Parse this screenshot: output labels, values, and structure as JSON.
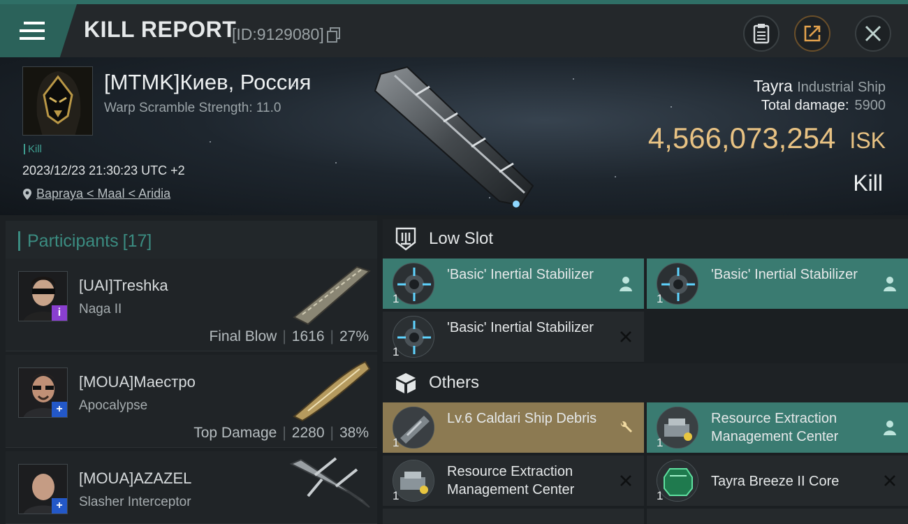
{
  "header": {
    "title": "KILL REPORT",
    "report_id": "[ID:9129080]",
    "icons": [
      "menu-icon",
      "copy-icon",
      "clipboard-icon",
      "share-icon",
      "close-icon"
    ]
  },
  "victim": {
    "name": "[MTMK]Киев, Россия",
    "warp_scramble": "Warp Scramble Strength: 11.0",
    "tag": "Kill",
    "datetime": "2023/12/23 21:30:23 UTC +2",
    "location": "Bapraya < Maal < Aridia"
  },
  "ship": {
    "name": "Tayra",
    "class": "Industrial Ship",
    "total_damage_label": "Total damage:",
    "total_damage_value": "5900",
    "isk_value": "4,566,073,254",
    "isk_unit": "ISK",
    "result": "Kill"
  },
  "participants": {
    "header_label": "Participants",
    "header_count": "[17]",
    "rows": [
      {
        "name": "[UAI]Treshka",
        "ship": "Naga II",
        "role": "Final Blow",
        "damage": "1616",
        "percent": "27%",
        "badge": "i",
        "badge_color": "#8a3fcf"
      },
      {
        "name": "[MOUA]Маестро",
        "ship": "Apocalypse",
        "role": "Top Damage",
        "damage": "2280",
        "percent": "38%",
        "badge": "+",
        "badge_color": "#2358c8"
      },
      {
        "name": "[MOUA]AZAZEL",
        "ship": "Slasher Interceptor",
        "role": "",
        "damage": "",
        "percent": "",
        "badge": "+",
        "badge_color": "#2358c8"
      }
    ]
  },
  "fitting": {
    "low_slot": {
      "label": "Low Slot",
      "items": [
        {
          "name": "'Basic' Inertial Stabilizer",
          "qty": "1",
          "status": "person-icon",
          "style": "teal"
        },
        {
          "name": "'Basic' Inertial Stabilizer",
          "qty": "1",
          "status": "person-icon",
          "style": "teal"
        },
        {
          "name": "'Basic' Inertial Stabilizer",
          "qty": "1",
          "status": "x-icon",
          "style": "dark"
        }
      ]
    },
    "others": {
      "label": "Others",
      "items": [
        {
          "name": "Lv.6 Caldari Ship Debris",
          "qty": "1",
          "status": "wrench-icon",
          "style": "gold"
        },
        {
          "name": "Resource Extraction Management Center",
          "qty": "1",
          "status": "person-icon",
          "style": "teal"
        },
        {
          "name": "Resource Extraction Management Center",
          "qty": "1",
          "status": "x-icon",
          "style": "dark"
        },
        {
          "name": "Tayra Breeze II Core",
          "qty": "1",
          "status": "x-icon",
          "style": "dark"
        }
      ]
    }
  },
  "colors": {
    "accent_teal": "#3a7b71",
    "isk_gold": "#e8c283",
    "gold_slot": "#8c7a52"
  }
}
